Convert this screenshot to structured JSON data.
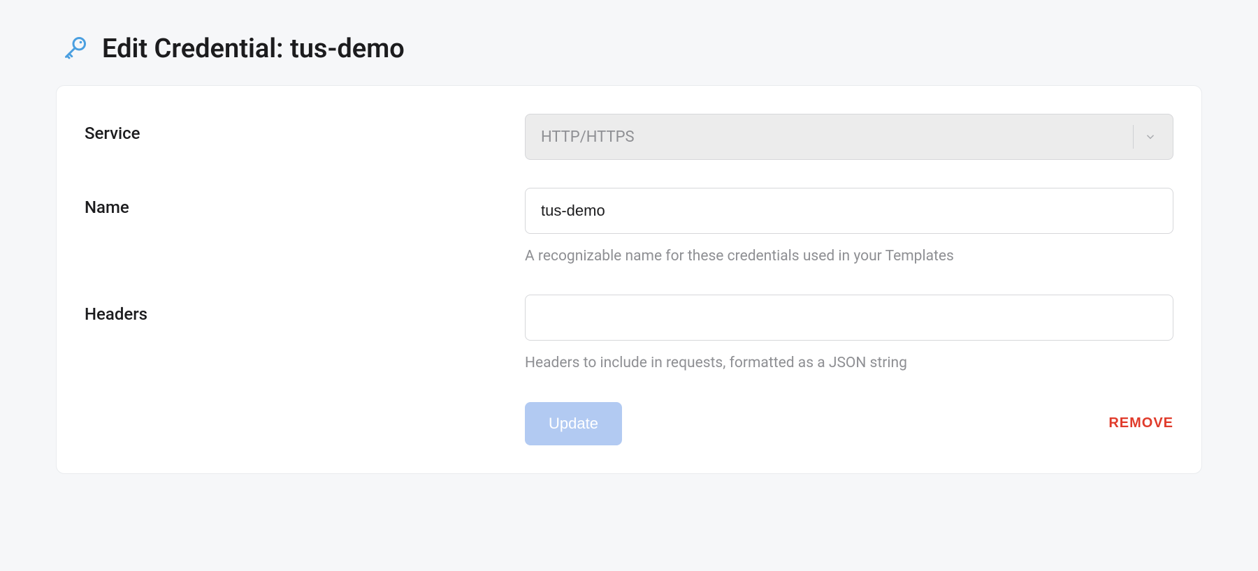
{
  "page": {
    "title": "Edit Credential: tus-demo"
  },
  "form": {
    "service": {
      "label": "Service",
      "value": "HTTP/HTTPS"
    },
    "name": {
      "label": "Name",
      "value": "tus-demo",
      "help": "A recognizable name for these credentials used in your Templates"
    },
    "headers": {
      "label": "Headers",
      "value": "",
      "help": "Headers to include in requests, formatted as a JSON string"
    }
  },
  "actions": {
    "update": "Update",
    "remove": "REMOVE"
  }
}
